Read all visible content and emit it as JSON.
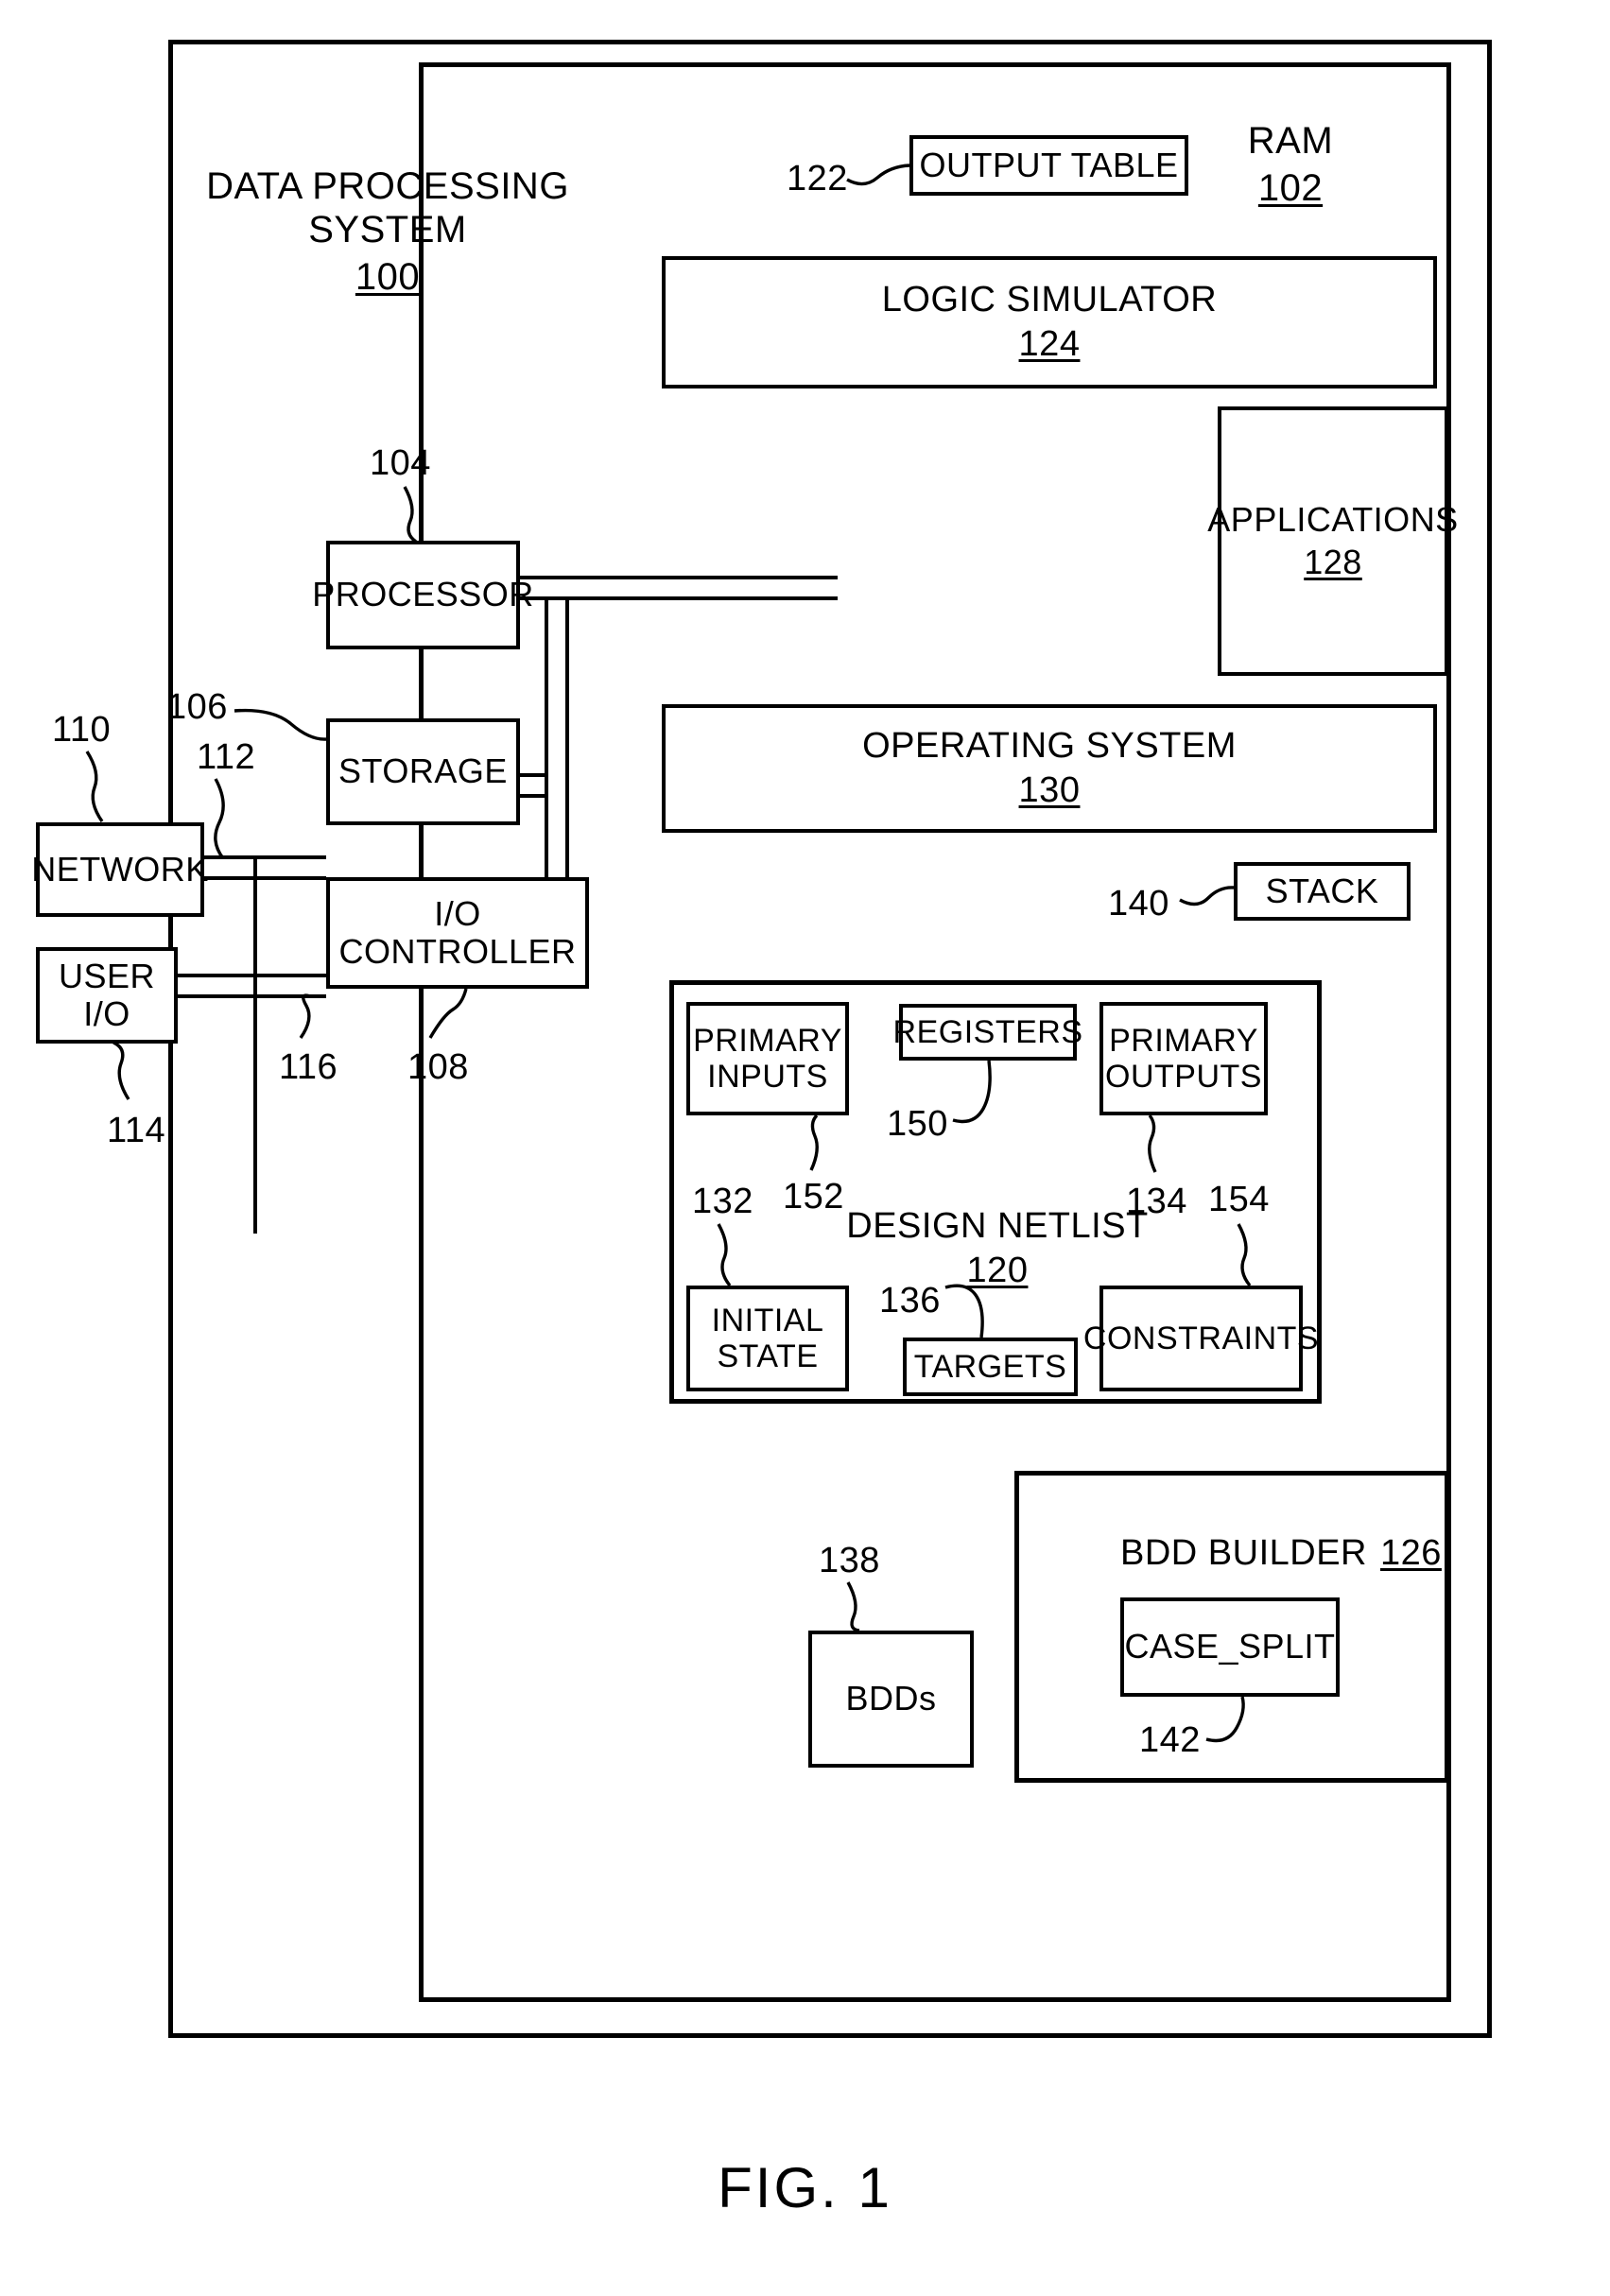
{
  "figure": {
    "caption": "FIG. 1"
  },
  "system": {
    "title": "DATA PROCESSING\nSYSTEM",
    "number": "100"
  },
  "ram": {
    "title": "RAM",
    "number": "102"
  },
  "hardware": {
    "processor": {
      "label": "PROCESSOR",
      "number": "104"
    },
    "storage": {
      "label": "STORAGE",
      "number": "106"
    },
    "io_controller": {
      "label": "I/O CONTROLLER",
      "number": "108"
    },
    "network": {
      "label": "NETWORK",
      "number": "110"
    },
    "user_io": {
      "label": "USER I/O",
      "number": "114"
    },
    "bus_network": {
      "number": "112"
    },
    "bus_user_io": {
      "number": "116"
    }
  },
  "memory": {
    "output_table": {
      "label": "OUTPUT TABLE",
      "number": "122"
    },
    "logic_simulator": {
      "label": "LOGIC SIMULATOR",
      "number": "124"
    },
    "applications": {
      "label": "APPLICATIONS",
      "number": "128"
    },
    "operating_system": {
      "label": "OPERATING SYSTEM",
      "number": "130"
    },
    "stack": {
      "label": "STACK",
      "number": "140"
    },
    "bdds": {
      "label": "BDDs",
      "number": "138"
    }
  },
  "design_netlist": {
    "title": "DESIGN NETLIST",
    "number": "120",
    "primary_inputs": {
      "label": "PRIMARY\nINPUTS",
      "number": "132"
    },
    "registers": {
      "label": "REGISTERS",
      "number": "150"
    },
    "primary_outputs": {
      "label": "PRIMARY\nOUTPUTS",
      "number": "134"
    },
    "initial_state": {
      "label": "INITIAL\nSTATE",
      "number": "152"
    },
    "targets": {
      "label": "TARGETS",
      "number": "136"
    },
    "constraints": {
      "label": "CONSTRAINTS",
      "number": "154"
    }
  },
  "bdd_builder": {
    "title": "BDD BUILDER",
    "number": "126",
    "case_split": {
      "label": "CASE_SPLIT",
      "number": "142"
    }
  }
}
